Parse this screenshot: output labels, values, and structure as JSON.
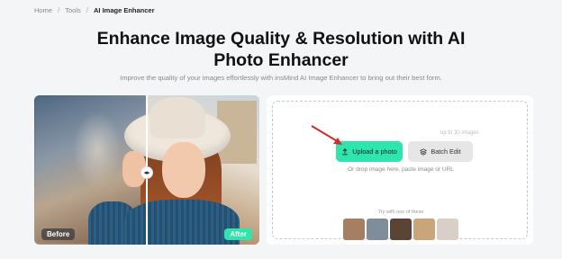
{
  "breadcrumb": {
    "items": [
      "Home",
      "Tools",
      "AI Image Enhancer"
    ],
    "separator": "/"
  },
  "title": "Enhance Image Quality & Resolution with AI Photo Enhancer",
  "subtitle": "Improve the quality of your images effortlessly with insMind AI Image Enhancer to bring out their best form.",
  "compare": {
    "before_label": "Before",
    "after_label": "After",
    "handle_icon": "◂▸"
  },
  "upload": {
    "limit_note": "up to 30 images",
    "upload_button": "Upload a photo",
    "batch_button": "Batch Edit",
    "drop_hint": "Or drop image here, paste image or URL",
    "try_label": "Try with one of these",
    "samples": [
      {
        "name": "sample-woman-portrait",
        "color": "#a67f63"
      },
      {
        "name": "sample-bridge",
        "color": "#7f8c99"
      },
      {
        "name": "sample-family",
        "color": "#5a4534"
      },
      {
        "name": "sample-blonde-woman",
        "color": "#c9a57a"
      },
      {
        "name": "sample-girl-portrait",
        "color": "#d8cfc6"
      }
    ]
  },
  "colors": {
    "accent": "#2ee6ad",
    "arrow": "#d42a2a"
  }
}
